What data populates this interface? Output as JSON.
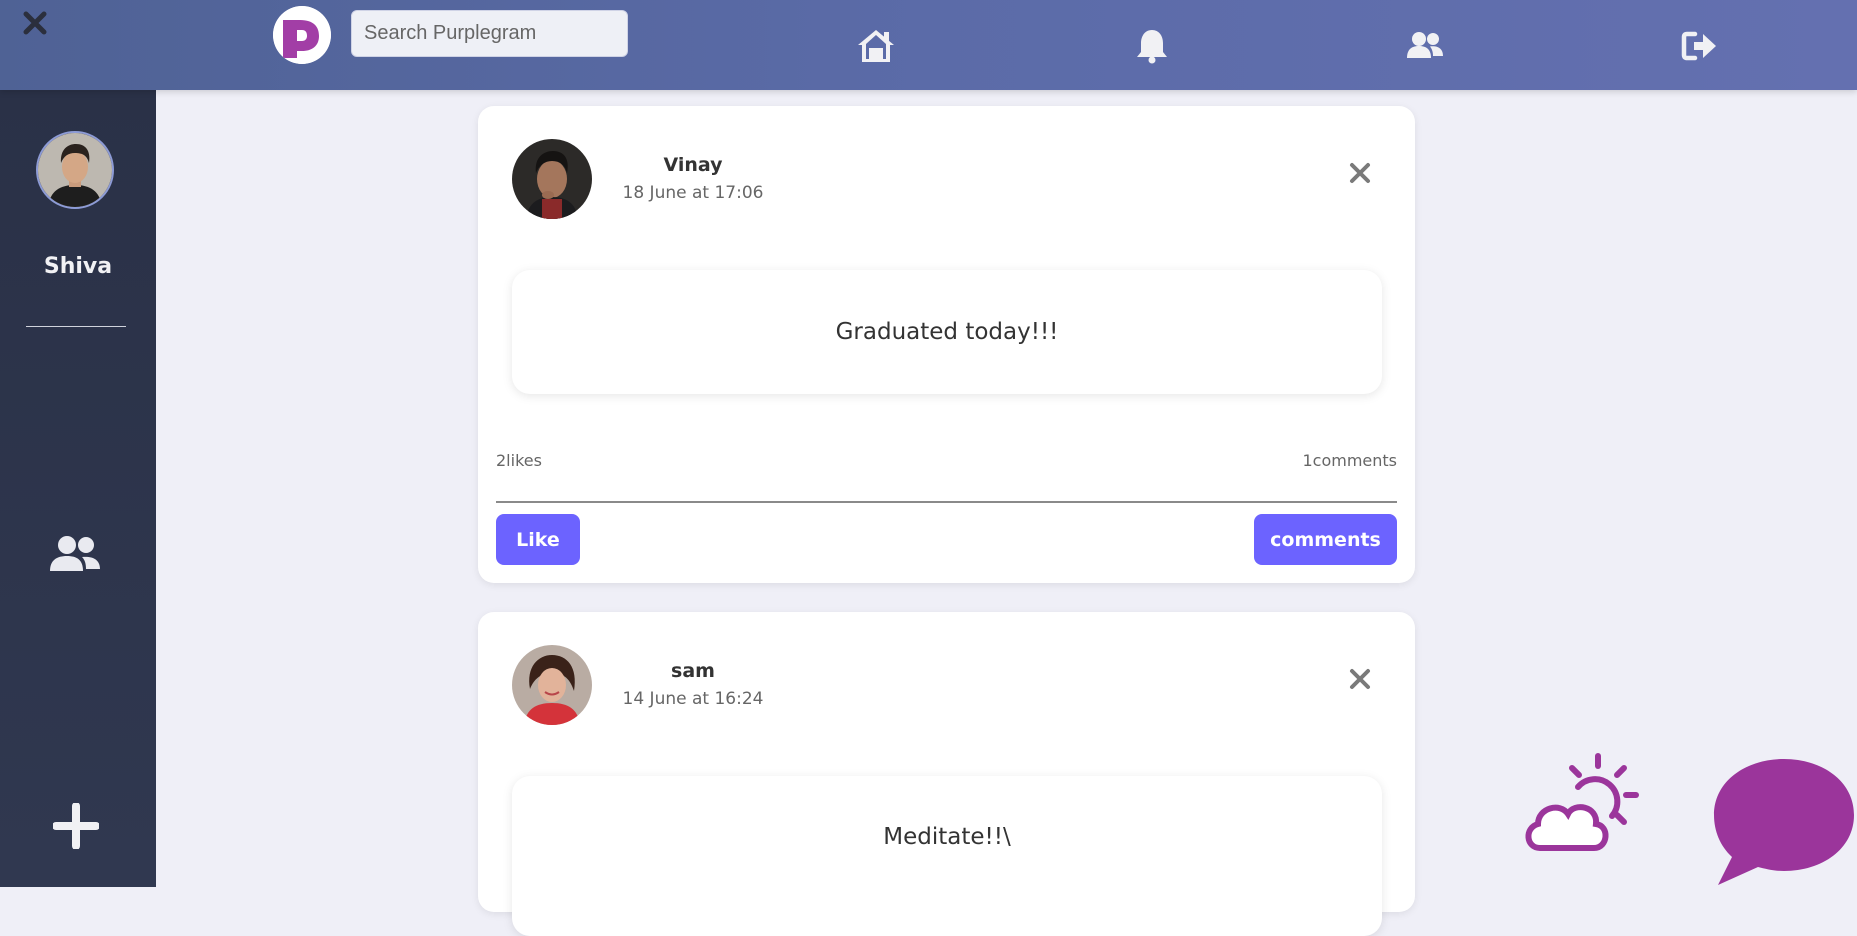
{
  "app": {
    "name": "Purplegram",
    "logo_letter": "P"
  },
  "header": {
    "search_placeholder": "Search Purplegram",
    "nav": [
      {
        "icon": "home-icon"
      },
      {
        "icon": "bell-icon"
      },
      {
        "icon": "friends-icon"
      },
      {
        "icon": "logout-icon"
      }
    ]
  },
  "sidebar": {
    "user_name": "Shiva",
    "friends_icon": "friends-icon",
    "add_icon": "plus-icon"
  },
  "posts": [
    {
      "author": "Vinay",
      "time": "18 June at 17:06",
      "content": "Graduated today!!!",
      "likes": "2likes",
      "comments_count": "1comments",
      "like_label": "Like",
      "comments_label": "comments"
    },
    {
      "author": "sam",
      "time": "14 June at 16:24",
      "content": "Meditate!!\\"
    }
  ],
  "colors": {
    "accent": "#6c63ff",
    "brand_purple": "#9b359b",
    "topbar": "#5b6ba8",
    "sidebar": "#2d344b"
  }
}
